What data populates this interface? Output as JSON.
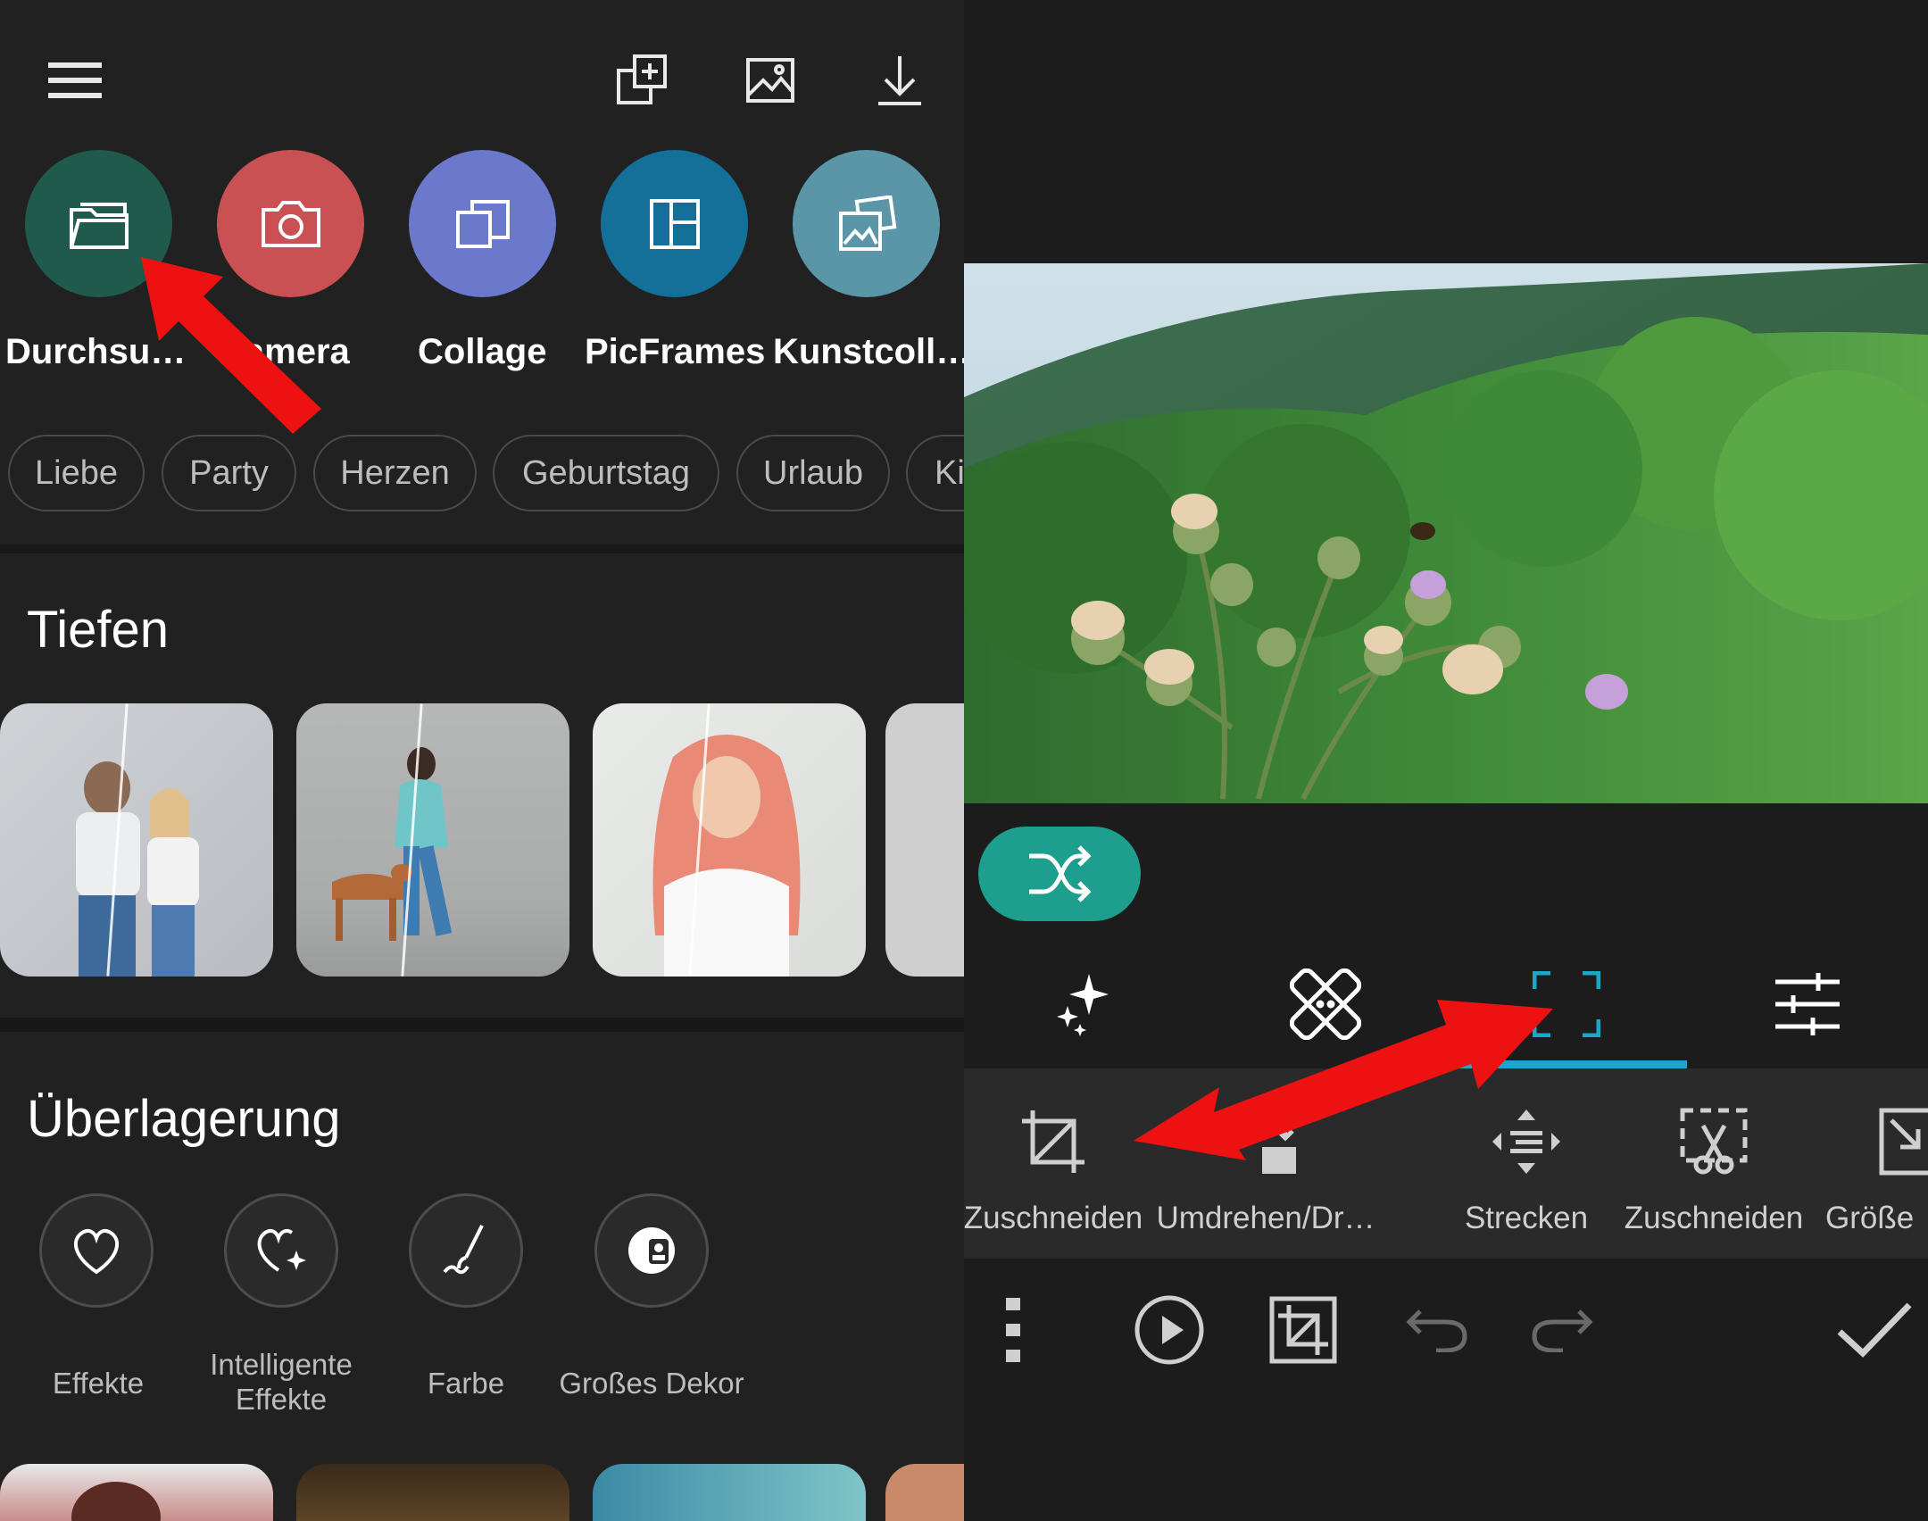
{
  "left_panel": {
    "quick_actions": [
      {
        "label": "Durchsu…",
        "icon": "folder-icon",
        "color": "#1f5a4c"
      },
      {
        "label": "Kamera",
        "icon": "camera-icon",
        "color": "#c95154"
      },
      {
        "label": "Collage",
        "icon": "collage-icon",
        "color": "#6a79cc"
      },
      {
        "label": "PicFrames",
        "icon": "frames-icon",
        "color": "#137098"
      },
      {
        "label": "Kunstcoll…",
        "icon": "art-collage-icon",
        "color": "#5a96a8"
      }
    ],
    "tags": [
      "Liebe",
      "Party",
      "Herzen",
      "Geburtstag",
      "Urlaub",
      "Ki"
    ],
    "sections": {
      "depth_title": "Tiefen",
      "overlay_title": "Überlagerung"
    },
    "effects": [
      {
        "label": "Effekte",
        "icon": "heart-effect-icon"
      },
      {
        "label": "Intelligente\nEffekte",
        "icon": "smart-effect-icon"
      },
      {
        "label": "Farbe",
        "icon": "brush-icon"
      },
      {
        "label": "Großes Dekor",
        "icon": "decor-icon"
      }
    ]
  },
  "right_panel": {
    "tabs": [
      {
        "name": "magic",
        "icon": "sparkle-icon"
      },
      {
        "name": "healing",
        "icon": "bandage-icon"
      },
      {
        "name": "crop",
        "icon": "crop-frame-icon",
        "active": true
      },
      {
        "name": "adjust",
        "icon": "sliders-icon"
      }
    ],
    "tools": [
      {
        "label": "Zuschneiden",
        "icon": "crop-icon"
      },
      {
        "label": "Umdrehen/Dr…",
        "icon": "flip-rotate-icon"
      },
      {
        "label": "Strecken",
        "icon": "stretch-icon"
      },
      {
        "label": "Zuschneiden",
        "icon": "free-crop-icon"
      },
      {
        "label": "Größe",
        "icon": "resize-icon"
      }
    ],
    "accent_color": "#1da7c7",
    "shuffle_color": "#1e9e8c"
  },
  "annotation": {
    "arrow_color": "#ee1111"
  }
}
